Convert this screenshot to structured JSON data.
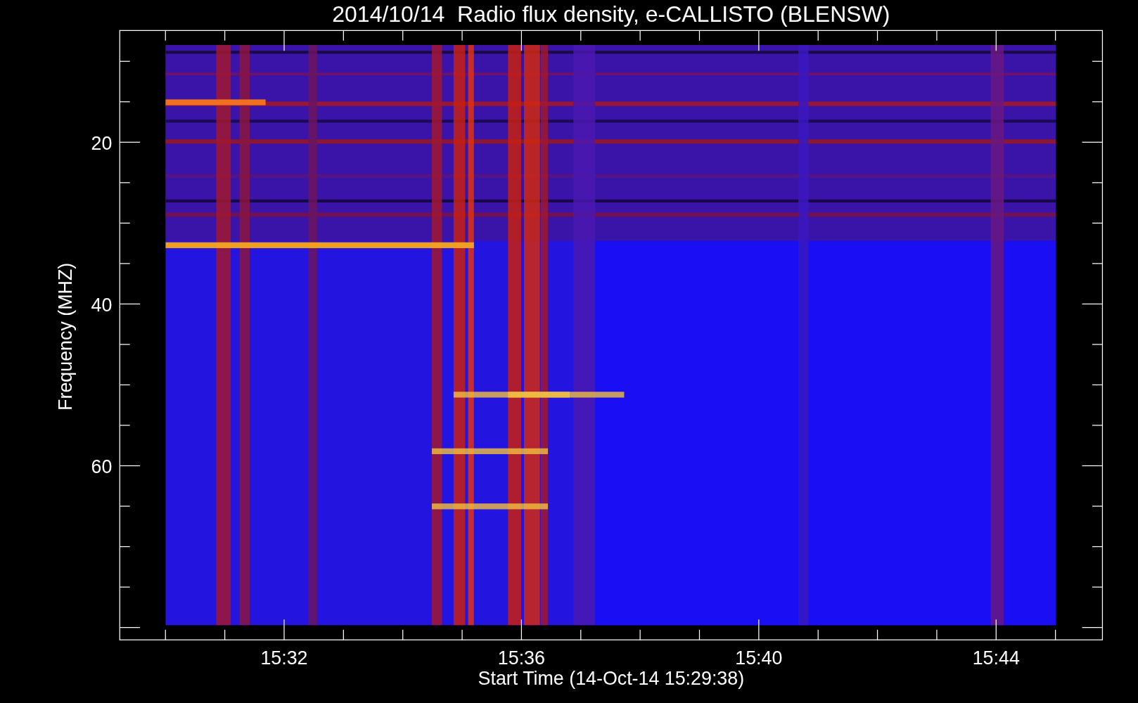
{
  "title": "2014/10/14  Radio flux density, e-CALLISTO (BLENSW)",
  "y_axis": {
    "label": "Frequency (MHZ)",
    "ticks": [
      "20",
      "40",
      "60"
    ]
  },
  "x_axis": {
    "label": "Start Time (14-Oct-14 15:29:38)",
    "ticks": [
      "15:32",
      "15:36",
      "15:40",
      "15:44"
    ]
  }
}
